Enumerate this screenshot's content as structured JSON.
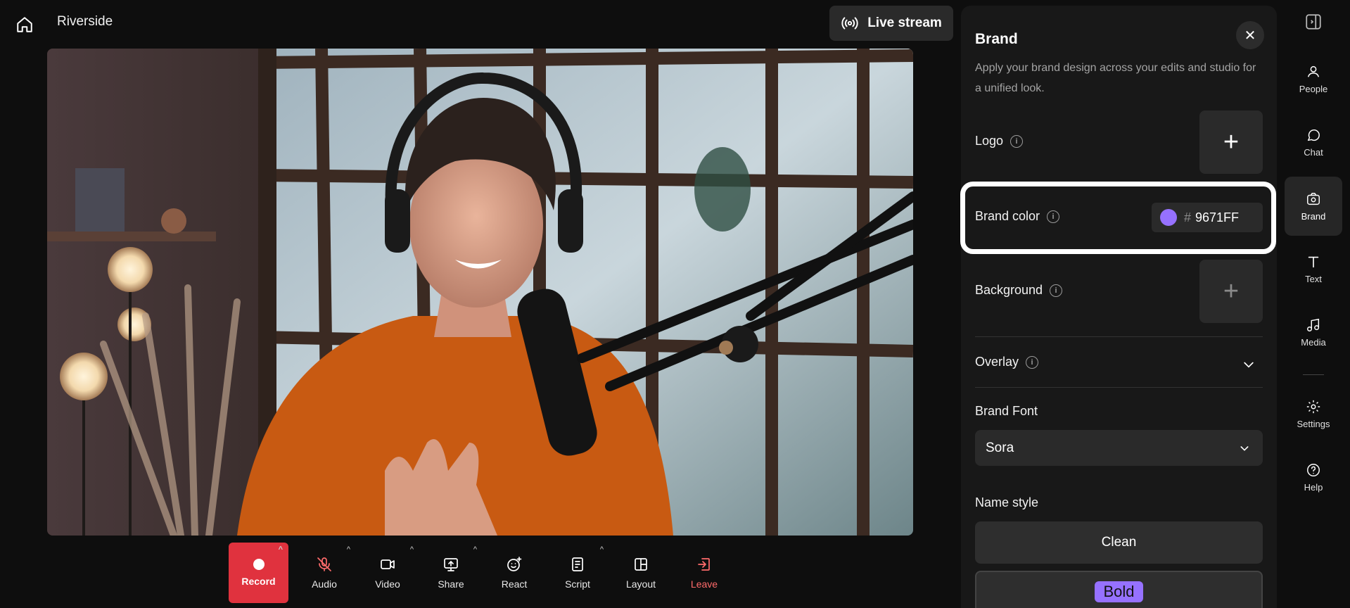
{
  "header": {
    "home_icon": "home-icon",
    "app_title": "Riverside",
    "live_label": "Live stream",
    "live_icon": "broadcast-icon"
  },
  "controls": [
    {
      "id": "record",
      "label": "Record",
      "icon": "record-dot-icon"
    },
    {
      "id": "audio",
      "label": "Audio",
      "icon": "mic-off-icon"
    },
    {
      "id": "video",
      "label": "Video",
      "icon": "camera-icon"
    },
    {
      "id": "share",
      "label": "Share",
      "icon": "screen-share-icon"
    },
    {
      "id": "react",
      "label": "React",
      "icon": "emoji-add-icon"
    },
    {
      "id": "script",
      "label": "Script",
      "icon": "document-icon"
    },
    {
      "id": "layout",
      "label": "Layout",
      "icon": "layout-icon"
    },
    {
      "id": "leave",
      "label": "Leave",
      "icon": "exit-icon"
    }
  ],
  "brand_panel": {
    "title": "Brand",
    "description": "Apply your brand design across your edits and studio for a unified look.",
    "logo_label": "Logo",
    "brand_color_label": "Brand color",
    "brand_color_hash": "#",
    "brand_color_value": "9671FF",
    "brand_color_hex": "#9671ff",
    "background_label": "Background",
    "overlay_label": "Overlay",
    "font_label": "Brand Font",
    "font_value": "Sora",
    "name_style_label": "Name style",
    "name_styles": [
      "Clean",
      "Bold"
    ],
    "add_symbol": "+",
    "close_symbol": "✕"
  },
  "rail": [
    {
      "id": "people",
      "label": "People",
      "icon": "people-icon"
    },
    {
      "id": "chat",
      "label": "Chat",
      "icon": "chat-icon"
    },
    {
      "id": "brand",
      "label": "Brand",
      "icon": "brand-icon",
      "active": true
    },
    {
      "id": "text",
      "label": "Text",
      "icon": "text-icon"
    },
    {
      "id": "media",
      "label": "Media",
      "icon": "music-note-icon"
    },
    {
      "id": "settings",
      "label": "Settings",
      "icon": "gear-icon"
    },
    {
      "id": "help",
      "label": "Help",
      "icon": "help-icon"
    }
  ],
  "colors": {
    "record": "#e0323e",
    "leave": "#ff6b6b",
    "accent": "#9671ff"
  }
}
